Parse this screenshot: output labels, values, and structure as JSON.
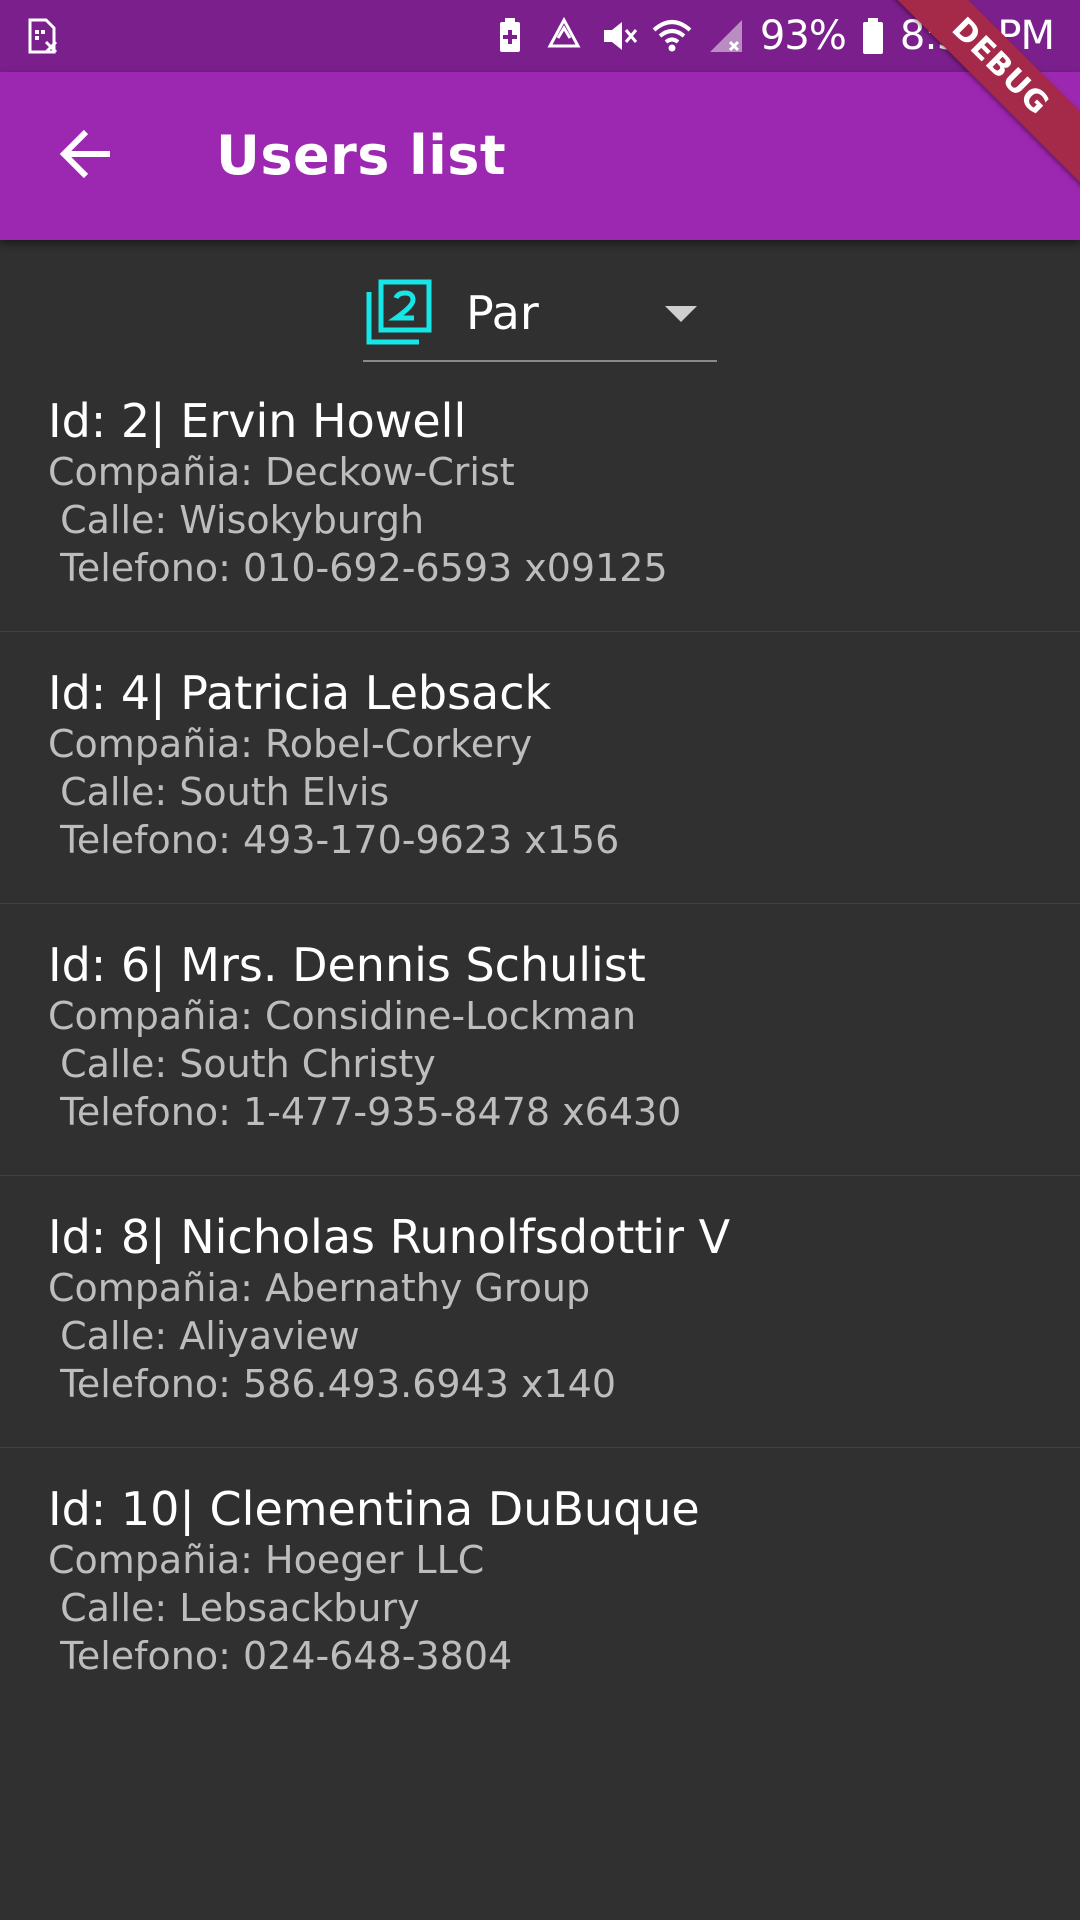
{
  "status_bar": {
    "battery_percent": "93%",
    "time": "8:38 PM",
    "icons": [
      "sim-card-icon",
      "battery-saver-icon",
      "recycle-icon",
      "mute-icon",
      "wifi-icon",
      "signal-icon",
      "battery-icon"
    ]
  },
  "app_bar": {
    "title": "Users list",
    "back_icon": "arrow-back-icon",
    "debug_label": "DEBUG",
    "color": "#9c27b0"
  },
  "filter": {
    "selected": "Par",
    "icon": "filter-2-icon",
    "icon_color": "#18e6e6"
  },
  "users": [
    {
      "title": "Id: 2| Ervin Howell",
      "company": "Compañia: Deckow-Crist",
      "street": " Calle: Wisokyburgh",
      "phone": " Telefono: 010-692-6593 x09125"
    },
    {
      "title": "Id: 4| Patricia Lebsack",
      "company": "Compañia: Robel-Corkery",
      "street": " Calle: South Elvis",
      "phone": " Telefono: 493-170-9623 x156"
    },
    {
      "title": "Id: 6| Mrs. Dennis Schulist",
      "company": "Compañia: Considine-Lockman",
      "street": " Calle: South Christy",
      "phone": " Telefono: 1-477-935-8478 x6430"
    },
    {
      "title": "Id: 8| Nicholas Runolfsdottir V",
      "company": "Compañia: Abernathy Group",
      "street": " Calle: Aliyaview",
      "phone": " Telefono: 586.493.6943 x140"
    },
    {
      "title": "Id: 10| Clementina DuBuque",
      "company": "Compañia: Hoeger LLC",
      "street": " Calle: Lebsackbury",
      "phone": " Telefono: 024-648-3804"
    }
  ]
}
